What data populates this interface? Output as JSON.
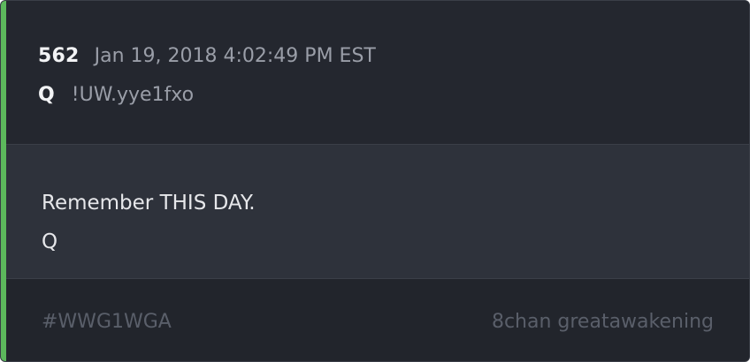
{
  "post": {
    "number": "562",
    "date": "Jan 19, 2018 4:02:49 PM EST",
    "author": "Q",
    "tripcode": "!UW.yye1fxo",
    "message_lines": [
      "Remember THIS DAY.",
      "Q"
    ],
    "hashtag": "#WWG1WGA",
    "source": "8chan greatawakening"
  },
  "colors": {
    "accent": "#5cb85c",
    "header_bg": "#24272f",
    "body_bg": "#2e323b",
    "footer_bg": "#22252c"
  }
}
